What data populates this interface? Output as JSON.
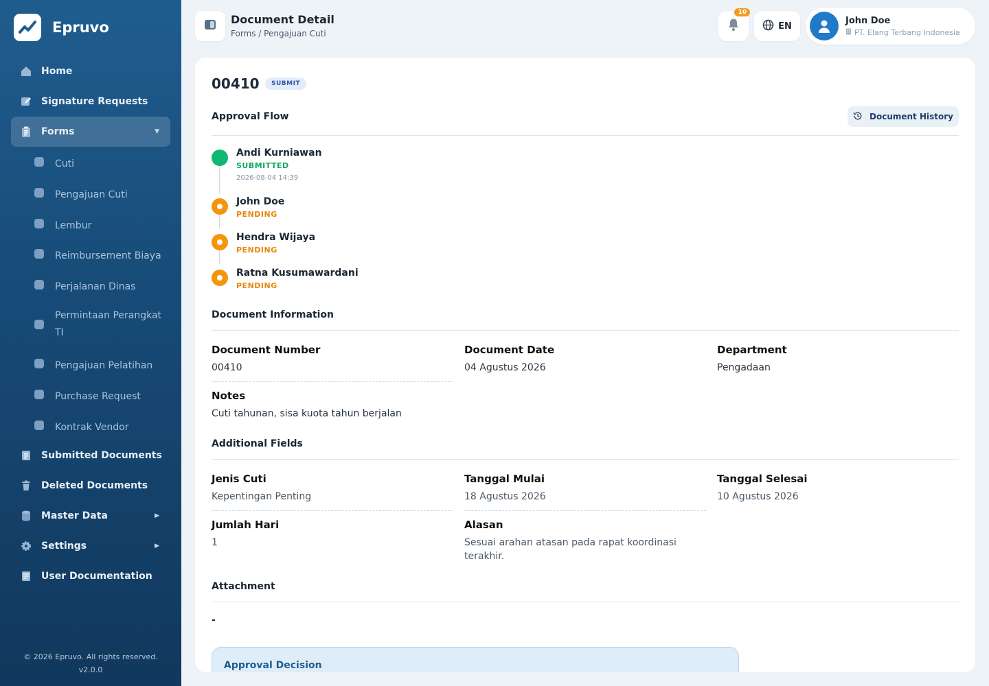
{
  "app": {
    "name": "Epruvo",
    "footer_copyright": "© 2026 Epruvo. All rights reserved.",
    "footer_version": "v2.0.0"
  },
  "sidebar": {
    "items": [
      {
        "label": "Home",
        "icon": "home-icon"
      },
      {
        "label": "Signature Requests",
        "icon": "pen-icon"
      },
      {
        "label": "Forms",
        "icon": "clipboard-icon",
        "active": true,
        "expanded": true
      }
    ],
    "sub_items": [
      "Cuti",
      "Pengajuan Cuti",
      "Lembur",
      "Reimbursement Biaya",
      "Perjalanan Dinas",
      "Permintaan Perangkat TI",
      "Pengajuan Pelatihan",
      "Purchase Request",
      "Kontrak Vendor"
    ],
    "bottom_items": [
      {
        "label": "Submitted Documents",
        "icon": "document-icon"
      },
      {
        "label": "Deleted Documents",
        "icon": "trash-icon"
      },
      {
        "label": "Master Data",
        "icon": "database-icon"
      },
      {
        "label": "Settings",
        "icon": "gear-icon"
      },
      {
        "label": "User Documentation",
        "icon": "book-icon"
      }
    ]
  },
  "header": {
    "title": "Document Detail",
    "breadcrumb": "Forms / Pengajuan Cuti",
    "notification_count": "10",
    "language": "EN",
    "user_name": "John Doe",
    "user_company": "PT. Elang Terbang Indonesia"
  },
  "document": {
    "number": "00410",
    "status": "SUBMIT",
    "history_button": "Document History"
  },
  "approval_flow": {
    "title": "Approval Flow",
    "steps": [
      {
        "name": "Andi Kurniawan",
        "status": "SUBMITTED",
        "time": "2026-08-04 14:39"
      },
      {
        "name": "John Doe",
        "status": "PENDING"
      },
      {
        "name": "Hendra Wijaya",
        "status": "PENDING"
      },
      {
        "name": "Ratna Kusumawardani",
        "status": "PENDING"
      }
    ]
  },
  "document_information": {
    "title": "Document Information",
    "number_label": "Document Number",
    "number_value": "00410",
    "date_label": "Document Date",
    "date_value": "04 Agustus 2026",
    "department_label": "Department",
    "department_value": "Pengadaan",
    "notes_label": "Notes",
    "notes_value": "Cuti tahunan, sisa kuota tahun berjalan"
  },
  "additional_fields": {
    "title": "Additional Fields",
    "jenis_label": "Jenis Cuti",
    "jenis_value": "Kepentingan Penting",
    "mulai_label": "Tanggal Mulai",
    "mulai_value": "18 Agustus 2026",
    "selesai_label": "Tanggal Selesai",
    "selesai_value": "10 Agustus 2026",
    "jumlah_label": "Jumlah Hari",
    "jumlah_value": "1",
    "alasan_label": "Alasan",
    "alasan_value": "Sesuai arahan atasan pada rapat koordinasi terakhir."
  },
  "attachment": {
    "title": "Attachment",
    "value": "-"
  },
  "approval_decision": {
    "title": "Approval Decision"
  },
  "colors": {
    "sidebar": "#1f5d8f",
    "submitted": "#11b874",
    "pending": "#f5950e",
    "badge": "#e3ecfb"
  }
}
